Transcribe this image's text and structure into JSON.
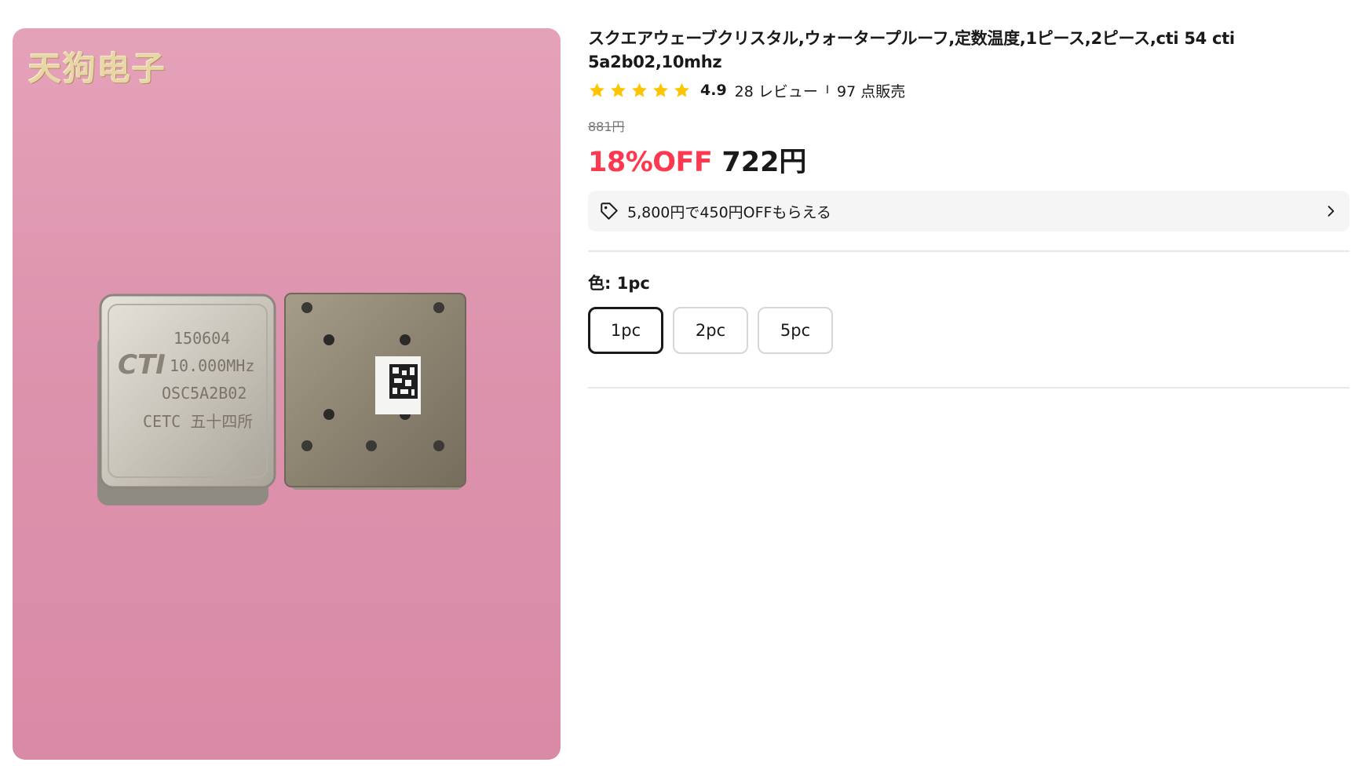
{
  "gallery": {
    "watermark": "天狗电子",
    "chip_front": {
      "lines": [
        "150604",
        "10.000MHz",
        "OSC5A2B02",
        "CETC 五十四所"
      ],
      "logo": "CTI"
    }
  },
  "product": {
    "title": "スクエアウェーブクリスタル,ウォータープルーフ,定数温度,1ピース,2ピース,cti 54 cti 5a2b02,10mhz",
    "rating": "4.9",
    "star_count": 5,
    "reviews": "28 レビュー",
    "separator": "I",
    "sold": "97 点販売",
    "original_price": "881円",
    "discount": "18%OFF",
    "price": "722円",
    "coupon": {
      "text": "5,800円で450円OFFもらえる",
      "icon": "tag-icon",
      "arrow_icon": "chevron-right-icon"
    },
    "option_group": {
      "label": "色:",
      "selected_value": "1pc",
      "options": [
        "1pc",
        "2pc",
        "5pc"
      ],
      "selected_index": 0
    }
  },
  "colors": {
    "discount": "#fd384f",
    "star": "#fdc400",
    "text": "#191919",
    "muted": "#757575",
    "coupon_bg": "#f5f5f5",
    "image_bg": "#e4a2b9"
  }
}
